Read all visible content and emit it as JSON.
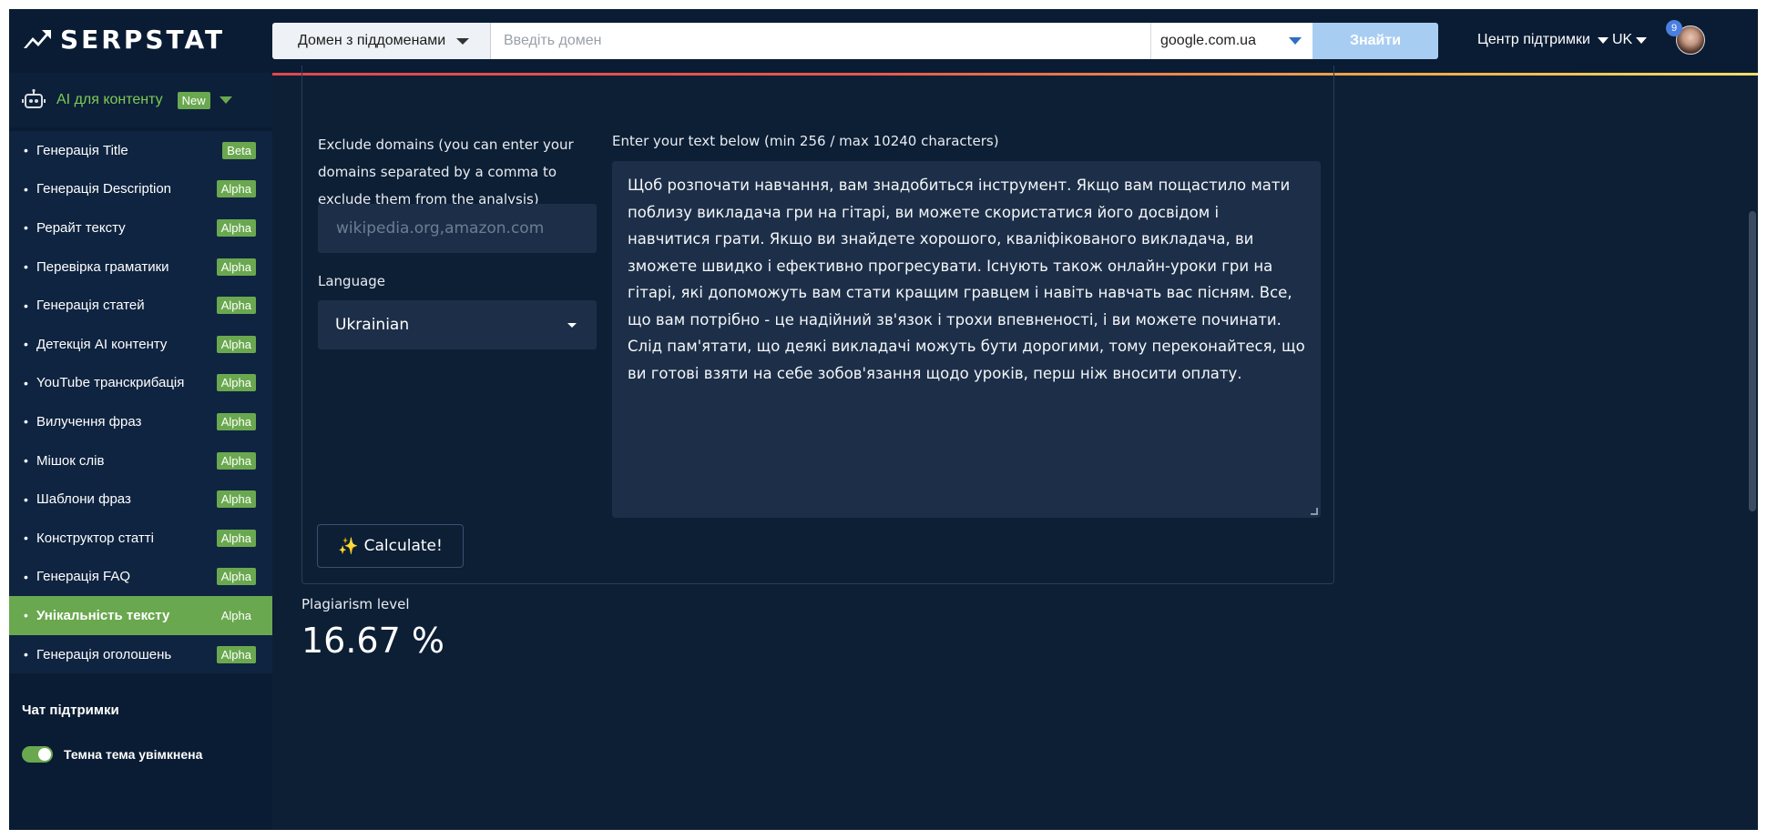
{
  "logo": {
    "text": "SERPSTAT"
  },
  "sidebar": {
    "section": {
      "label": "AI для контенту",
      "badge": "New"
    },
    "items": [
      {
        "label": "Генерація Title",
        "tag": "Beta"
      },
      {
        "label": "Генерація Description",
        "tag": "Alpha"
      },
      {
        "label": "Рерайт тексту",
        "tag": "Alpha"
      },
      {
        "label": "Перевірка граматики",
        "tag": "Alpha"
      },
      {
        "label": "Генерація статей",
        "tag": "Alpha"
      },
      {
        "label": "Детекція AI контенту",
        "tag": "Alpha"
      },
      {
        "label": "YouTube транскрибація",
        "tag": "Alpha"
      },
      {
        "label": "Вилучення фраз",
        "tag": "Alpha"
      },
      {
        "label": "Мішок слів",
        "tag": "Alpha"
      },
      {
        "label": "Шаблони фраз",
        "tag": "Alpha"
      },
      {
        "label": "Конструктор статті",
        "tag": "Alpha"
      },
      {
        "label": "Генерація FAQ",
        "tag": "Alpha"
      },
      {
        "label": "Унікальність тексту",
        "tag": "Alpha",
        "active": true
      },
      {
        "label": "Генерація оголошень",
        "tag": "Alpha"
      }
    ],
    "support_chat": "Чат підтримки",
    "theme_label": "Темна тема увімкнена"
  },
  "header": {
    "domain_mode": "Домен з піддоменами",
    "domain_placeholder": "Введіть домен",
    "search_engine": "google.com.ua",
    "find_label": "Знайти",
    "support_center": "Центр підтримки",
    "language": "UK",
    "notifications": "9"
  },
  "form": {
    "exclude_label": "Exclude domains (you can enter your domains separated by a comma to exclude them from the analysis)",
    "exclude_placeholder": "wikipedia.org,amazon.com",
    "language_label": "Language",
    "language_value": "Ukrainian",
    "text_label": "Enter your text below (min 256 / max 10240 characters)",
    "text_value": "Щоб розпочати навчання, вам знадобиться інструмент. Якщо вам пощастило мати поблизу викладача гри на гітарі, ви можете скористатися його досвідом і навчитися грати. Якщо ви знайдете хорошого, кваліфікованого викладача, ви зможете швидко і ефективно прогресувати. Існують також онлайн-уроки гри на гітарі, які допоможуть вам стати кращим гравцем і навіть навчать вас пісням. Все, що вам потрібно - це надійний зв'язок і трохи впевненості, і ви можете починати. Слід пам'ятати, що деякі викладачі можуть бути дорогими, тому переконайтеся, що ви готові взяти на себе зобов'язання щодо уроків, перш ніж вносити оплату.",
    "calculate_label": "Calculate!"
  },
  "result": {
    "label": "Plagiarism level",
    "value": "16.67 %"
  },
  "colors": {
    "background": "#0d1f35",
    "sidebar": "#0a1c33",
    "accent_green": "#6aa84f",
    "input_bg": "#1d2f48",
    "find_button": "#a8cdf2"
  }
}
